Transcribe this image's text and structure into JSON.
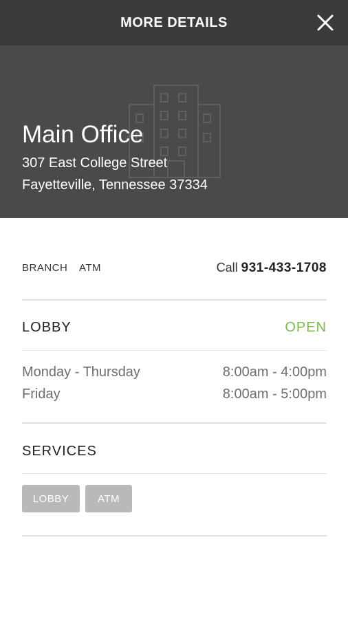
{
  "header": {
    "title": "MORE DETAILS",
    "close_icon": "close-icon"
  },
  "hero": {
    "name": "Main Office",
    "address_line1": "307 East College Street",
    "address_line2": "Fayetteville, Tennessee 37334",
    "background_icon": "building-icon"
  },
  "location": {
    "types": [
      "BRANCH",
      "ATM"
    ],
    "call_label": "Call",
    "phone": "931-433-1708"
  },
  "lobby": {
    "title": "LOBBY",
    "status": "OPEN",
    "status_color": "#76c043",
    "hours": [
      {
        "days": "Monday - Thursday",
        "time": "8:00am - 4:00pm"
      },
      {
        "days": "Friday",
        "time": "8:00am - 5:00pm"
      }
    ]
  },
  "services": {
    "title": "SERVICES",
    "items": [
      "LOBBY",
      "ATM"
    ]
  },
  "colors": {
    "header_bg": "#3b3b3b",
    "hero_bg": "#4a4a4a",
    "chip_bg": "#b9b9b9"
  }
}
